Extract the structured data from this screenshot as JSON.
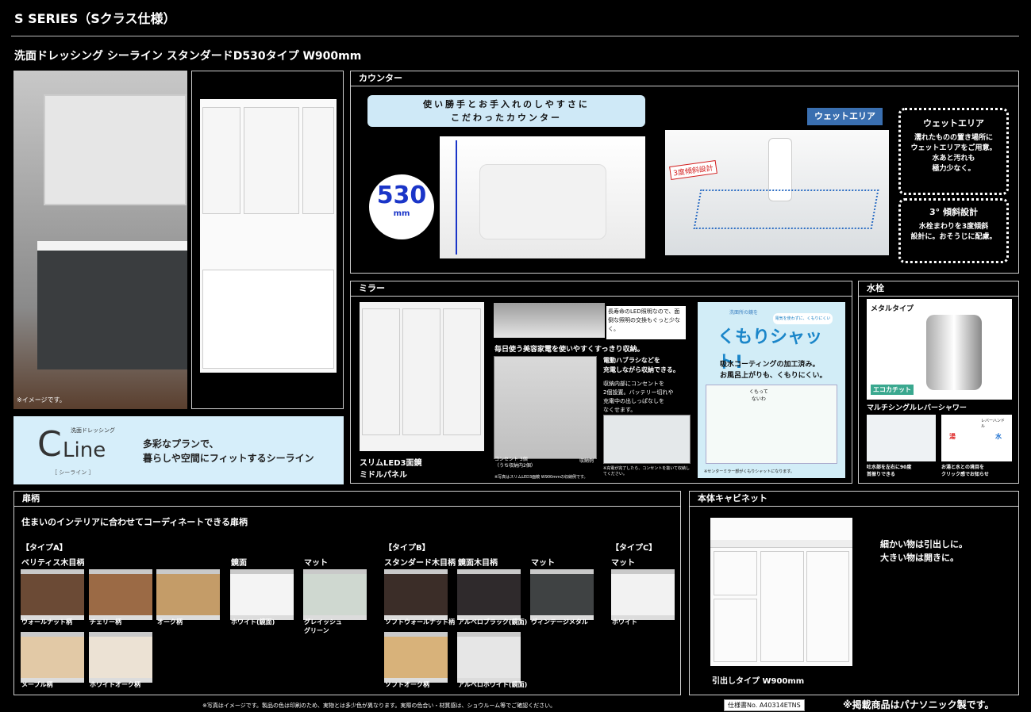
{
  "header": {
    "series": "S  SERIES（Sクラス仕様）",
    "product": "洗面ドレッシング  シーライン  スタンダードD530タイプ  W900mm"
  },
  "hero": {
    "image_note": "※イメージです。"
  },
  "cline": {
    "small": "洗面ドレッシング",
    "logo": "Line",
    "logo_c": "C",
    "kana": "［ シーライン ］",
    "text_line1": "多彩なプランで、",
    "text_line2": "暮らしや空間にフィットするシーライン"
  },
  "counter": {
    "title": "カウンター",
    "banner_line1": "使い勝手とお手入れのしやすさに",
    "banner_line2": "こだわったカウンター",
    "depth_value": "530",
    "depth_unit": "mm",
    "wet_area_tag": "ウェットエリア",
    "tilt_tag": "3度傾斜設計",
    "box1_title": "ウェットエリア",
    "box1_text": "濡れたものの置き場所に\nウェットエリアをご用意。\n水あと汚れも\n極力少なく。",
    "box2_title": "3°  傾斜設計",
    "box2_text": "水栓まわりを3度傾斜\n設計に。おそうじに配慮。"
  },
  "mirror": {
    "title": "ミラー",
    "mirror_caption_1": "スリムLED3面鏡",
    "mirror_caption_2": "ミドルパネル",
    "led_text": "長寿命のLED照明なので、面倒な照明の交換もぐっと少なく。",
    "storage_title": "毎日使う美容家電を使いやすくすっきり収納。",
    "storage_text1": "電動ハブラシなどを\n充電しながら収納できる。",
    "storage_text2": "収納内部にコンセントを\n2個設置。バッテリー切れや\n充電中の出しっぱなしを\nなくせます。",
    "outlet_label": "コンセント 3個\n（うち収納内2個）",
    "storage_label": "収納例",
    "photo_note": "※写真はスリムLED3面鏡 W900mmの収納例です。",
    "charge_note": "※充電が完了したら、コンセントを抜いて収納してください。",
    "kumori_small": "洗面所の鏡を",
    "kumori_bubble": "電気を使わずに、くもりにくい",
    "kumori_title": "くもりシャット!",
    "kumori_text": "吸水コーティングの加工済み。\nお風呂上がりも、くもりにくい。",
    "kumori_bubble2": "くもって\nないわ",
    "kumori_note": "※センターミラー部がくもりシャットになります。"
  },
  "faucet": {
    "title": "水栓",
    "metal_tag": "メタルタイプ",
    "eco_tag": "エコカチット",
    "name": "マルチシングルレバーシャワー",
    "cap1": "吐水部を左右に90度\n首振りできる",
    "cap2": "お湯と水との境目を\nクリック感でお知らせ",
    "lever_label": "レバーハンドル",
    "hot_label": "湯",
    "cold_label": "水"
  },
  "doors": {
    "title": "扉柄",
    "subtitle": "住まいのインテリアに合わせてコーディネートできる扉柄",
    "typeA": "【タイプA】",
    "typeB": "【タイプB】",
    "typeC": "【タイプC】",
    "groupA1": "ベリティス木目柄",
    "groupA2": "鏡面",
    "groupA3": "マット",
    "groupB1": "スタンダード木目柄",
    "groupB2": "鏡面木目柄",
    "groupB3": "マット",
    "groupC1": "マット",
    "swatches": [
      {
        "label": "ウォールナット柄",
        "color": "#6b4a35"
      },
      {
        "label": "チェリー柄",
        "color": "#9b6a45"
      },
      {
        "label": "オーク柄",
        "color": "#c49c68"
      },
      {
        "label": "ホワイト(鏡面)",
        "color": "#f4f4f4"
      },
      {
        "label": "グレイッシュ\nグリーン",
        "color": "#cfd8d0"
      },
      {
        "label": "ソフトウォールナット柄",
        "color": "#3b2d28"
      },
      {
        "label": "アルベロブラック(鏡面)",
        "color": "#2f2a2c"
      },
      {
        "label": "ヴィンテージメタル",
        "color": "#3f4243"
      },
      {
        "label": "ホワイト",
        "color": "#f2f2f2"
      },
      {
        "label": "メープル柄",
        "color": "#e2c9a6"
      },
      {
        "label": "ホワイトオーク柄",
        "color": "#ece2d4"
      },
      {
        "label": "ソフトオーク柄",
        "color": "#d8b27a"
      },
      {
        "label": "アルベロホワイト(鏡面)",
        "color": "#e6e6e6"
      }
    ]
  },
  "cabinet": {
    "title": "本体キャビネット",
    "text_line1": "細かい物は引出しに。",
    "text_line2": "大きい物は開きに。",
    "caption": "引出しタイプ  W900mm"
  },
  "footer": {
    "disclaimer": "※写真はイメージです。製品の色は印刷のため、実物とは多少色が異なります。実際の色合い・材質感は、ショウルーム等でご確認ください。",
    "spec_no": "仕様書No. A40314ETNS",
    "maker_note": "※掲載商品はパナソニック製です。"
  },
  "colors": {
    "banner_bg": "#cfe9f7",
    "wet_tag_bg": "#3a6fb0",
    "cline_bg": "#d6eefa",
    "accent_blue": "#1a35c8"
  }
}
